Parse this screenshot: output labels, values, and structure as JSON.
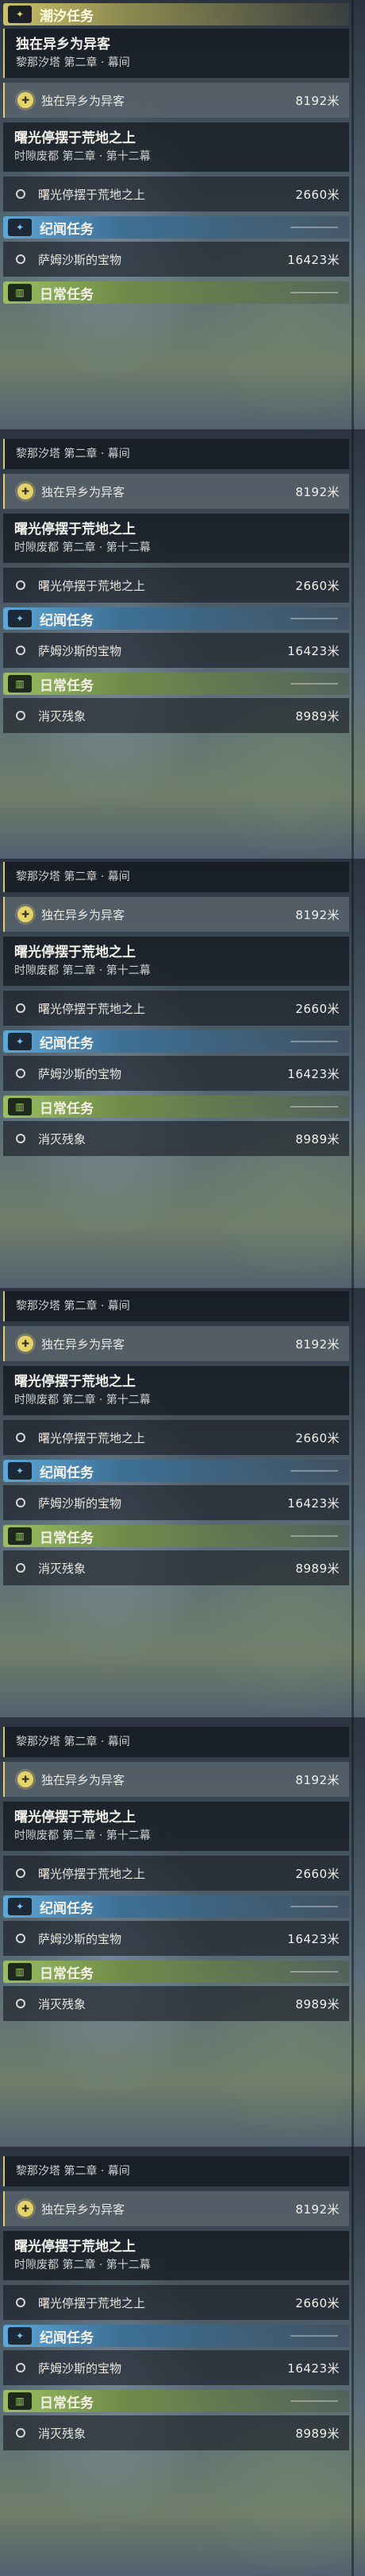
{
  "sections": {
    "main_label": "潮汐任务",
    "side_label": "纪闻任务",
    "daily_label": "日常任务"
  },
  "main_quest": {
    "title": "独在异乡为异客",
    "subtitle": "黎那汐塔 第二章 · 幕间",
    "objective": "独在异乡为异客",
    "distance": "8192米"
  },
  "second_quest": {
    "title": "曙光停摆于荒地之上",
    "subtitle": "时隙废都 第二章 · 第十二幕",
    "objective": "曙光停摆于荒地之上",
    "distance": "2660米"
  },
  "side_quest": {
    "objective": "萨姆沙斯的宝物",
    "distance": "16423米"
  },
  "daily_quest": {
    "objective": "消灭残象",
    "distance": "8989米"
  },
  "icons": {
    "main": "sparkle-icon",
    "side": "sparkle-icon",
    "daily": "book-icon",
    "target": "target-icon",
    "todo": "circle-icon"
  },
  "colors": {
    "main_accent": "#c9c06a",
    "side_accent": "#5ea7d8",
    "daily_accent": "#9bbf63"
  }
}
